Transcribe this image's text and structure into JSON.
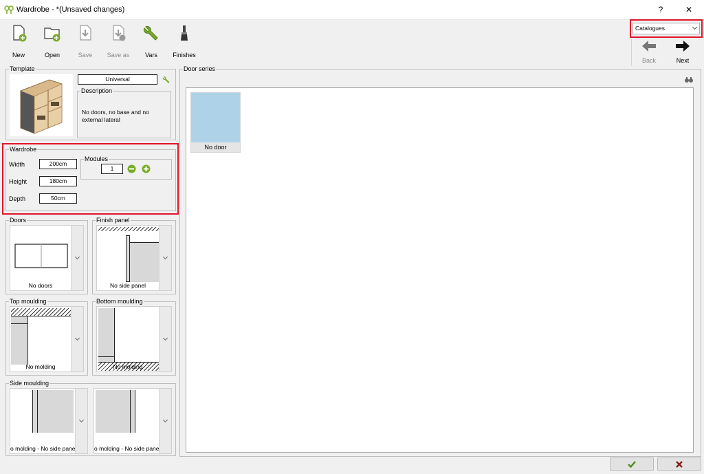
{
  "window": {
    "title": "Wardrobe -  *(Unsaved changes)",
    "help": "?",
    "close": "✕"
  },
  "toolbar": {
    "new": "New",
    "open": "Open",
    "save": "Save",
    "save_as": "Save as",
    "vars": "Vars",
    "finishes": "Finishes"
  },
  "nav": {
    "catalogues": "Catalogues",
    "back": "Back",
    "next": "Next"
  },
  "template": {
    "label": "Template",
    "name": "Universal",
    "description_label": "Description",
    "description": "No doors, no base and no external lateral"
  },
  "wardrobe": {
    "label": "Wardrobe",
    "width_label": "Width",
    "width": "200cm",
    "height_label": "Height",
    "height": "180cm",
    "depth_label": "Depth",
    "depth": "50cm",
    "modules_label": "Modules",
    "modules": "1"
  },
  "doors": {
    "label": "Doors",
    "value": "No doors"
  },
  "finish_panel": {
    "label": "Finish panel",
    "value": "No side panel"
  },
  "top_moulding": {
    "label": "Top moulding",
    "value": "No molding"
  },
  "bottom_moulding": {
    "label": "Bottom moulding",
    "value": "No molding"
  },
  "side_moulding": {
    "label": "Side moulding",
    "left": "o molding - No side pane",
    "right": "o molding - No side pane"
  },
  "door_series": {
    "label": "Door series",
    "items": [
      {
        "label": "No door",
        "color": "#aed3e9"
      }
    ]
  },
  "colors": {
    "accent_red": "#e0162b",
    "green": "#7bab2a"
  }
}
